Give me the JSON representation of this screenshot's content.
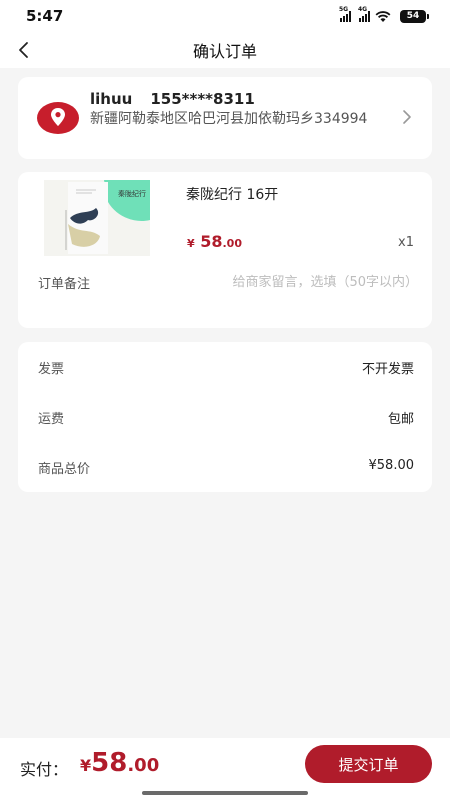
{
  "status_bar": {
    "time": "5:47",
    "net_tag_1": "5G",
    "net_tag_2": "4G",
    "battery": "54"
  },
  "header": {
    "title": "确认订单",
    "back_icon": "chevron-left-icon"
  },
  "address": {
    "name": "lihuu",
    "phone": "155****8311",
    "detail": "新疆阿勒泰地区哈巴河县加依勒玛乡334994",
    "icon": "location-pin-icon"
  },
  "product": {
    "title": "秦陇纪行 16开",
    "cover_text": "秦陇纪行",
    "price_symbol": "¥",
    "price_int": "58",
    "price_dec": ".00",
    "quantity": "x1"
  },
  "remark": {
    "label": "订单备注",
    "placeholder": "给商家留言，选填（50字以内）",
    "value": ""
  },
  "summary": [
    {
      "label": "发票",
      "value": "不开发票"
    },
    {
      "label": "运费",
      "value": "包邮"
    },
    {
      "label": "商品总价",
      "value": "¥58.00"
    }
  ],
  "footer": {
    "pay_label": "实付：",
    "price_symbol": "¥",
    "price_int": "58",
    "price_dec": ".00",
    "submit_label": "提交订单"
  },
  "colors": {
    "accent": "#b01c2b",
    "background": "#f5f5f5",
    "card": "#ffffff"
  }
}
